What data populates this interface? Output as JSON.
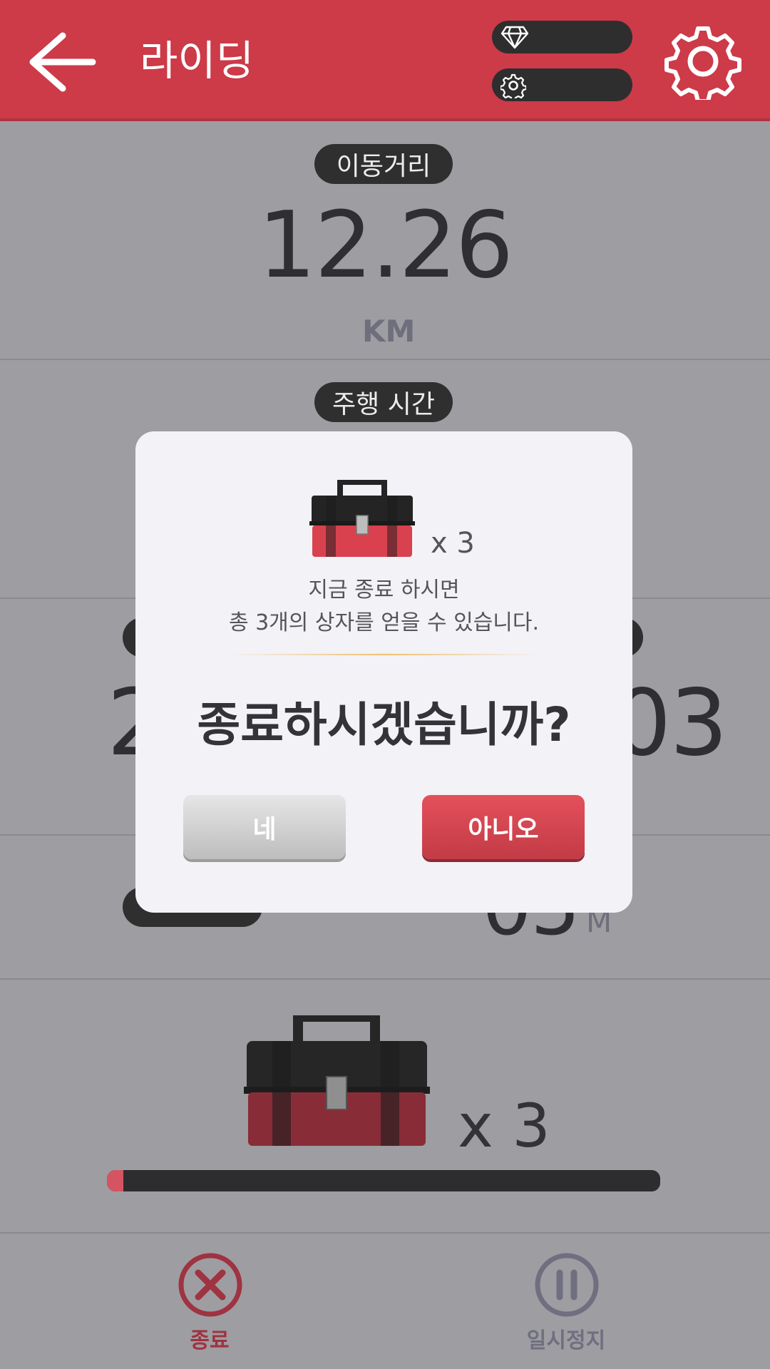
{
  "header": {
    "title": "라이딩",
    "gems_value": "",
    "parts_value": ""
  },
  "stats": {
    "distance": {
      "label": "이동거리",
      "value": "12.26",
      "unit": "KM"
    },
    "time": {
      "label": "주행 시간"
    },
    "partial_left_number": "2",
    "partial_right_number": "03",
    "partial_bottom_value": "05",
    "partial_bottom_unit": "M"
  },
  "reward": {
    "count": "x 3",
    "progress_fraction": 0.03
  },
  "bottom": {
    "quit_label": "종료",
    "pause_label": "일시정지"
  },
  "modal": {
    "count": "x 3",
    "message_line1": "지금 종료 하시면",
    "message_line2": "총 3개의 상자를 얻을 수 있습니다.",
    "question": "종료하시겠습니까?",
    "yes_label": "네",
    "no_label": "아니오"
  },
  "colors": {
    "header": "#cd3a48",
    "accent_red": "#d94552",
    "dim_bg": "#9e9da2"
  },
  "icons": [
    "back-arrow-icon",
    "diamond-icon",
    "gear-icon",
    "toolbox-icon",
    "close-circle-icon",
    "pause-circle-icon"
  ]
}
